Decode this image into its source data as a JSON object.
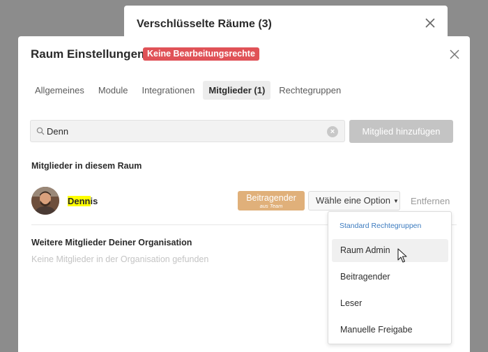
{
  "background_dialog": {
    "title": "Verschlüsselte Räume (3)"
  },
  "dialog": {
    "title": "Raum Einstellungen",
    "badge": "Keine Bearbeitungsrechte",
    "tabs": [
      {
        "label": "Allgemeines",
        "active": false
      },
      {
        "label": "Module",
        "active": false
      },
      {
        "label": "Integrationen",
        "active": false
      },
      {
        "label": "Mitglieder (1)",
        "active": true
      },
      {
        "label": "Rechtegruppen",
        "active": false
      }
    ],
    "search": {
      "value": "Denn",
      "clear_label": "×"
    },
    "add_member_label": "Mitglied hinzufügen",
    "members_section_title": "Mitglieder in diesem Raum",
    "members": [
      {
        "name_highlight": "Denn",
        "name_rest": "is",
        "role_label": "Beitragender",
        "role_source": "aus Team",
        "select_label": "Wähle eine Option",
        "remove_label": "Entfernen"
      }
    ],
    "org_section_title": "Weitere Mitglieder Deiner Organisation",
    "org_empty_text": "Keine Mitglieder in der Organisation gefunden",
    "dropdown": {
      "group_label": "Standard Rechtegruppen",
      "options": [
        "Raum Admin",
        "Beitragender",
        "Leser",
        "Manuelle Freigabe"
      ],
      "hovered": "Raum Admin"
    }
  },
  "colors": {
    "badge": "#e05257",
    "role_badge": "#e0b07a",
    "group_label": "#3c7bbf",
    "highlight": "#ffff00",
    "overlay": "#8c8c8c"
  }
}
